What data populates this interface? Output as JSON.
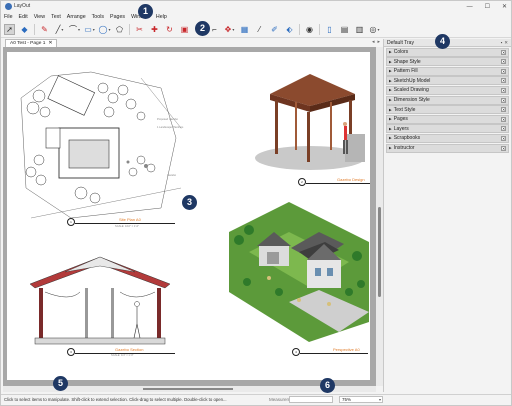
{
  "window": {
    "title": "LayOut",
    "controls": [
      "—",
      "☐",
      "✕"
    ]
  },
  "menu": [
    "File",
    "Edit",
    "View",
    "Text",
    "Arrange",
    "Tools",
    "Pages",
    "Window",
    "Help"
  ],
  "toolbar": {
    "icons": [
      "select-icon",
      "eraser-icon",
      "pencil-icon",
      "line-icon",
      "arc-icon",
      "rectangle-icon",
      "circle-icon",
      "polygon-icon",
      "split-icon",
      "join-icon",
      "rotate-icon",
      "offset-icon",
      "text-icon",
      "label-icon",
      "dimension-icon",
      "table-icon",
      "style-icon",
      "sample-icon",
      "paint-icon",
      "camera-icon",
      "add-page-icon",
      "duplicate-page-icon",
      "delete-page-icon",
      "presentation-icon"
    ]
  },
  "document": {
    "tab_label": "A0 Test - Page 1",
    "tab_close": "✕"
  },
  "canvas": {
    "viewports": [
      {
        "title": "Site Plan A0",
        "sub": "SCALE: 1/16\" = 1'-0\"",
        "marker": "1"
      },
      {
        "title": "Gazebo Design",
        "sub": "",
        "marker": "2"
      },
      {
        "title": "Gazebo Section",
        "sub": "SCALE: 1/4\" = 1'-0\"",
        "marker": "3"
      },
      {
        "title": "Perspective A0",
        "sub": "",
        "marker": "4"
      }
    ],
    "site_labels": [
      "Proposed Gazebo",
      "1 Landscape Plantings",
      "Gazebo"
    ]
  },
  "tray": {
    "title": "Default Tray",
    "panels": [
      "Colors",
      "Shape Style",
      "Pattern Fill",
      "SketchUp Model",
      "Scaled Drawing",
      "Dimension Style",
      "Text Style",
      "Pages",
      "Layers",
      "Scrapbooks",
      "Instructor"
    ]
  },
  "status": {
    "hint": "Click to select items to manipulate. Shift-click to extend selection. Click-drag to select multiple. Double-click to open...",
    "measurements_label": "Measurements",
    "measurements_value": "",
    "zoom": "75%"
  },
  "callouts": [
    "1",
    "2",
    "3",
    "4",
    "5",
    "6"
  ],
  "colors": {
    "accent": "#e07b28",
    "callout": "#1f3864",
    "toolbar_red": "#c8262a",
    "toolbar_blue": "#2b6cbf"
  }
}
